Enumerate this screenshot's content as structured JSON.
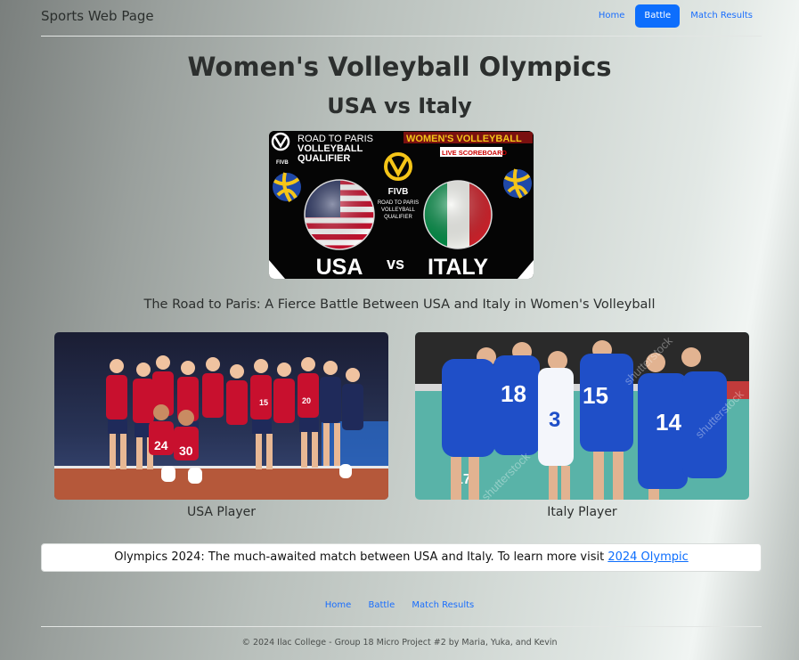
{
  "navbar": {
    "brand": "Sports Web Page",
    "links": [
      "Home",
      "Battle",
      "Match Results"
    ]
  },
  "main": {
    "title": "Women's Volleyball Olympics",
    "subtitle": "USA vs Italy",
    "banner": {
      "top_left": [
        "ROAD TO PARIS",
        "VOLLEYBALL",
        "QUALIFIER"
      ],
      "top_right": "WOMEN'S VOLLEYBALL",
      "live": "LIVE SCOREBOARD",
      "center_logo": "FIVB",
      "center_text": [
        "ROAD TO PARIS",
        "VOLLEYBALL",
        "QUALIFIER"
      ],
      "small_logo": "FIVB",
      "team_left": "USA",
      "vs": "vs",
      "team_right": "ITALY"
    },
    "caption": "The Road to Paris: A Fierce Battle Between USA and Italy in Women's Volleyball",
    "players": [
      {
        "label": "USA Player"
      },
      {
        "label": "Italy Player"
      }
    ]
  },
  "notice": {
    "text": "Olympics 2024: The much-awaited match between USA and Italy. To learn more visit ",
    "link": "2024 Olympic"
  },
  "footer": {
    "links": [
      "Home",
      "Battle",
      "Match Results"
    ],
    "copyright": "© 2024 Ilac College - Group 18 Micro Project #2 by Maria, Yuka, and Kevin"
  },
  "colors": {
    "accent": "#0d6efd",
    "usa_red": "#c8102e",
    "usa_navy": "#1f2a5a",
    "italy_blue": "#1f4fc8",
    "banner_gold": "#f5c518"
  }
}
